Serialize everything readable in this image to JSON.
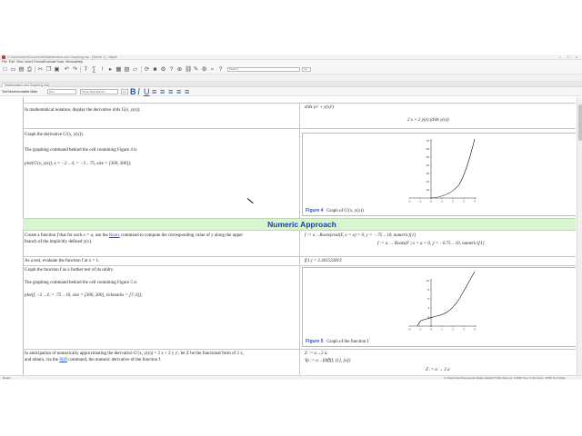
{
  "window": {
    "title": "C:\\Users\\User\\Documents\\Mathematics and Graphing.mw - [Server 1] - Maple",
    "controls": [
      "–",
      "□",
      "×"
    ]
  },
  "menu": [
    "File",
    "Edit",
    "View",
    "Insert",
    "Format",
    "Evaluate",
    "Tools",
    "Window",
    "Help"
  ],
  "toolbar": {
    "icons": [
      "new-icon",
      "open-icon",
      "save-icon",
      "print-icon",
      "cut-icon",
      "copy-icon",
      "paste-icon",
      "undo-icon",
      "redo-icon",
      "text-icon",
      "math-icon",
      "execute-icon",
      "insert-icon",
      "table-icon",
      "image-icon",
      "plot-icon",
      "restart-icon",
      "stop-icon",
      "debug-icon",
      "help-icon",
      "zoom-icon",
      "link-icon",
      "comment-icon",
      "settings-icon",
      "search-icon",
      "help2-icon"
    ],
    "glyphs": [
      "□",
      "▭",
      "▤",
      "⎙",
      "✂",
      "❐",
      "▣",
      "↶",
      "↷",
      "T",
      "∑",
      "!",
      "▸",
      "▦",
      "▨",
      "▱",
      "⟳",
      "■",
      "⚙",
      "?",
      "⊕",
      "⛓",
      "✎",
      "⚙",
      "⌕",
      "?"
    ],
    "search_placeholder": "Search",
    "search_button": "Go"
  },
  "tabs": [
    "Mathematics and Graphing.mw"
  ],
  "format_toolbar": {
    "mode_text": "Text",
    "mode_math": "Nonexecutable Math",
    "style_label": "Text",
    "font": "Times New Roman",
    "size": "12",
    "buttons": [
      "B",
      "I",
      "U",
      "≡",
      "≡",
      "≡",
      "≡",
      "≡"
    ]
  },
  "document": {
    "row0_left": "In mathematical notation, display the derivative",
    "row0_left_math": "d/dx G(x, y(x)).",
    "row0_right_line1": "d/dx (x² + y(x)²)",
    "row0_right_line2": "2 x + 2 y(x) (d/dx y(x))",
    "row1_left_line1": "Graph the derivative G′(x, y(x)).",
    "row1_left_line2": "The graphing command behind the cell containing Figure 4 is",
    "row1_left_cmd": "plot(G′(x, y(x)), x = −2 .. 4, = −3 .. 75, size = [300, 300]);",
    "figure4_label": "Figure 4",
    "figure4_caption": "Graph of G′(x, y(x))",
    "section_heading": "Numeric Approach",
    "row2_left_a": "Create a function",
    "row2_left_b": "that for each",
    "row2_left_c": ", use the",
    "row2_link_roots": "Roots",
    "row2_left_d": "command to compute the corresponding value of y along the upper",
    "row2_left_e": "branch of the implicitly defined y(x).",
    "row2_right_line1": "f := a→Roots(eval(F, x = a) = 0, y = −.75 .. 10, numeric)[1]",
    "row2_right_line2": "f := a → Roots(F | x = a = 0, y = −0.75 .. 10, numeric)[1]",
    "row3_left": "As a test, evaluate the function f at x = 1.",
    "row3_right": "f(1.) = 2.361532813",
    "row4_left_line1": "Graph the function f as a further test of its utility.",
    "row4_left_line2": "The graphing command behind the cell containing Figure 5 is",
    "row4_left_cmd": "plot(f, −2 .. 4, = .75 .. 10, size = [300, 300], tickmarks = [7, 6]);",
    "figure5_label": "Figure 5",
    "figure5_caption": "Graph of the function f",
    "row5_left_line1": "In anticipation of numerically approximating the derivative G′(x, y(x)) = 2 x + 2 y y′, let Z be the functional form of 2 x,",
    "row5_left_line2a": "and obtain, via the",
    "row5_link_fdiff": "fdiff",
    "row5_left_line2b": "command, the numeric derivative of the function f.",
    "row5_right_line1": "Z := a→2 a;",
    "row5_right_line2": "Yp := a→fdiff(f, [1], [a])",
    "row5_right_line3": "Z := a → 2 a"
  },
  "figure4": {
    "x_ticks": [
      "−2",
      "−1",
      "0",
      "1",
      "2",
      "3",
      "4"
    ],
    "y_ticks": [
      "10",
      "20",
      "30",
      "40",
      "50",
      "60",
      "70"
    ]
  },
  "figure5": {
    "x_ticks": [
      "−2",
      "−1",
      "0",
      "1",
      "2",
      "3",
      "4"
    ],
    "y_ticks": [
      "2",
      "4",
      "6",
      "8",
      "10"
    ]
  },
  "status": {
    "left": "Ready",
    "right": "C:\\Users\\User\\Documents   Maple Default Profile   Memory: 0.49M   Time: 0.11s   Zoom: 150%   Text Mode"
  }
}
